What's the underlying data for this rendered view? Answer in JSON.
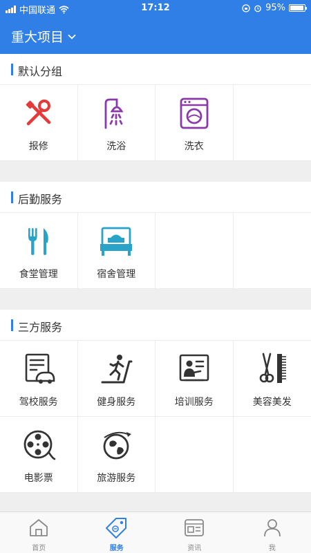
{
  "status_bar": {
    "carrier": "中国联通",
    "time": "17:12",
    "battery": "95%",
    "battery_level": 0.95
  },
  "header": {
    "title": "重大项目"
  },
  "sections": [
    {
      "title": "默认分组",
      "items": [
        {
          "label": "报修",
          "icon": "tools-icon"
        },
        {
          "label": "洗浴",
          "icon": "shower-icon"
        },
        {
          "label": "洗衣",
          "icon": "washing-machine-icon"
        }
      ]
    },
    {
      "title": "后勤服务",
      "items": [
        {
          "label": "食堂管理",
          "icon": "cutlery-icon"
        },
        {
          "label": "宿舍管理",
          "icon": "bed-icon"
        }
      ]
    },
    {
      "title": "三方服务",
      "items": [
        {
          "label": "驾校服务",
          "icon": "driving-school-icon"
        },
        {
          "label": "健身服务",
          "icon": "treadmill-icon"
        },
        {
          "label": "培训服务",
          "icon": "training-board-icon"
        },
        {
          "label": "美容美发",
          "icon": "scissors-comb-icon"
        },
        {
          "label": "电影票",
          "icon": "film-reel-icon"
        },
        {
          "label": "旅游服务",
          "icon": "globe-plane-icon"
        }
      ]
    }
  ],
  "tabbar": {
    "items": [
      {
        "label": "首页",
        "icon": "home-icon"
      },
      {
        "label": "服务",
        "icon": "service-tag-icon",
        "active": true
      },
      {
        "label": "资讯",
        "icon": "news-icon"
      },
      {
        "label": "我",
        "icon": "user-icon"
      }
    ]
  },
  "colors": {
    "primary": "#2f7fe6",
    "repair_red": "#e43a3a",
    "purple": "#8a3aa8",
    "teal": "#2aa3c9",
    "dark": "#333333",
    "tab_gray": "#888888"
  }
}
